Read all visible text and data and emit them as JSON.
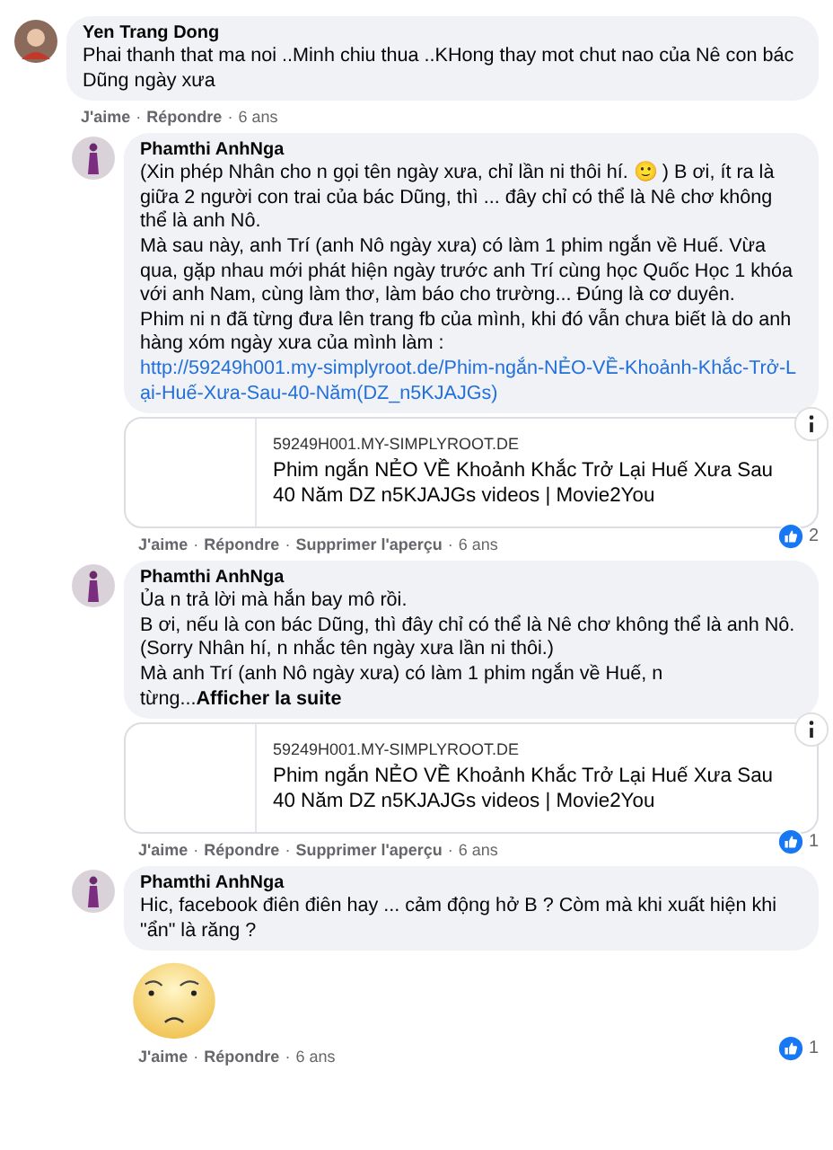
{
  "separator": "·",
  "comments": [
    {
      "author": "Yen Trang Dong",
      "paragraphs": [
        {
          "text": "Phai thanh that ma noi ..Minh chiu thua ..KHong thay mot chut nao của Nê con bác Dũng ngày xưa"
        }
      ],
      "actions": [
        "J'aime",
        "Répondre"
      ],
      "time": "6 ans",
      "children": [
        {
          "author": "Phamthi AnhNga",
          "paragraphs": [
            {
              "text": "(Xin phép Nhân cho n gọi tên ngày xưa, chỉ lần ni thôi hí. 🙂 ) B ơi, ít ra là giữa 2 người con trai của bác Dũng, thì ... đây chỉ có thể là Nê chơ không thể là anh Nô."
            },
            {
              "text": "Mà sau này, anh Trí (anh Nô ngày xưa) có làm 1 phim ngắn về Huế. Vừa qua, gặp nhau mới phát hiện ngày trước anh Trí cùng học Quốc Học 1 khóa với anh Nam, cùng làm thơ, làm báo cho trường... Đúng là cơ duyên."
            },
            {
              "text": "Phim ni n đã từng đưa lên trang fb của mình, khi đó vẫn chưa biết là do anh hàng xóm ngày xưa của mình làm :",
              "link": "http://59249h001.my-simplyroot.de/Phim-ngắn-NẺO-VỀ-Khoảnh-Khắc-Trở-Lại-Huế-Xưa-Sau-40-Năm(DZ_n5KJAJGs)"
            }
          ],
          "preview": {
            "domain": "59249H001.MY-SIMPLYROOT.DE",
            "title": "Phim ngắn NẺO VỀ Khoảnh Khắc Trở Lại Huế Xưa Sau 40 Năm DZ n5KJAJGs videos | Movie2You"
          },
          "likes": "2",
          "actions": [
            "J'aime",
            "Répondre",
            "Supprimer l'aperçu"
          ],
          "time": "6 ans"
        },
        {
          "author": "Phamthi AnhNga",
          "paragraphs": [
            {
              "text": "Ủa n trả lời mà hắn bay mô rồi."
            },
            {
              "text": "B ơi, nếu là con bác Dũng, thì đây chỉ có thể là Nê chơ không thể là anh Nô."
            },
            {
              "text": "(Sorry Nhân hí, n nhắc tên ngày xưa lần ni thôi.)"
            },
            {
              "text": "Mà anh Trí (anh Nô ngày xưa) có làm 1 phim ngắn về Huế, n từng...",
              "see_more": "Afficher la suite"
            }
          ],
          "preview": {
            "domain": "59249H001.MY-SIMPLYROOT.DE",
            "title": "Phim ngắn NẺO VỀ Khoảnh Khắc Trở Lại Huế Xưa Sau 40 Năm DZ n5KJAJGs videos | Movie2You"
          },
          "likes": "1",
          "actions": [
            "J'aime",
            "Répondre",
            "Supprimer l'aperçu"
          ],
          "time": "6 ans"
        },
        {
          "author": "Phamthi AnhNga",
          "paragraphs": [
            {
              "text": "Hic, facebook điên điên hay ... cảm động hở B ? Còm mà khi xuất hiện khi \"ẩn\" là răng ?"
            }
          ],
          "sticker": true,
          "likes": "1",
          "actions": [
            "J'aime",
            "Répondre"
          ],
          "time": "6 ans"
        }
      ]
    }
  ]
}
